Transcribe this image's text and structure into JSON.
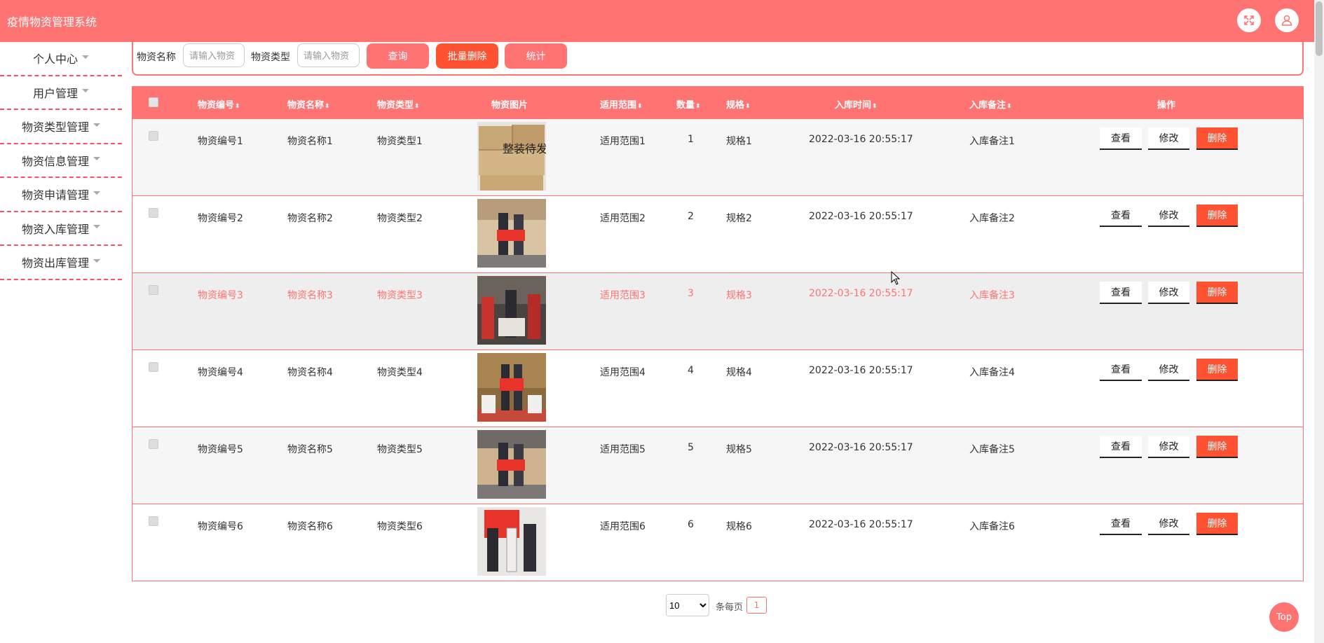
{
  "app": {
    "title": "疫情物资管理系统"
  },
  "header": {
    "fullscreen_icon": "expand-icon",
    "user_icon": "user-icon"
  },
  "sidebar": {
    "items": [
      {
        "label": "个人中心"
      },
      {
        "label": "用户管理"
      },
      {
        "label": "物资类型管理"
      },
      {
        "label": "物资信息管理"
      },
      {
        "label": "物资申请管理"
      },
      {
        "label": "物资入库管理"
      },
      {
        "label": "物资出库管理"
      }
    ]
  },
  "search": {
    "name_label": "物资名称",
    "name_placeholder": "请输入物资",
    "type_label": "物资类型",
    "type_placeholder": "请输入物资",
    "query_button": "查询",
    "batch_delete_button": "批量删除",
    "stats_button": "统计"
  },
  "table": {
    "columns": [
      "物资编号",
      "物资名称",
      "物资类型",
      "物资图片",
      "适用范围",
      "数量",
      "规格",
      "入库时间",
      "入库备注",
      "操作"
    ],
    "sort_icon": "sort-icon",
    "rows": [
      {
        "code": "物资编号1",
        "name": "物资名称1",
        "type": "物资类型1",
        "scope": "适用范围1",
        "qty": "1",
        "spec": "规格1",
        "time": "2022-03-16 20:55:17",
        "note": "入库备注1"
      },
      {
        "code": "物资编号2",
        "name": "物资名称2",
        "type": "物资类型2",
        "scope": "适用范围2",
        "qty": "2",
        "spec": "规格2",
        "time": "2022-03-16 20:55:17",
        "note": "入库备注2"
      },
      {
        "code": "物资编号3",
        "name": "物资名称3",
        "type": "物资类型3",
        "scope": "适用范围3",
        "qty": "3",
        "spec": "规格3",
        "time": "2022-03-16 20:55:17",
        "note": "入库备注3"
      },
      {
        "code": "物资编号4",
        "name": "物资名称4",
        "type": "物资类型4",
        "scope": "适用范围4",
        "qty": "4",
        "spec": "规格4",
        "time": "2022-03-16 20:55:17",
        "note": "入库备注4"
      },
      {
        "code": "物资编号5",
        "name": "物资名称5",
        "type": "物资类型5",
        "scope": "适用范围5",
        "qty": "5",
        "spec": "规格5",
        "time": "2022-03-16 20:55:17",
        "note": "入库备注5"
      },
      {
        "code": "物资编号6",
        "name": "物资名称6",
        "type": "物资类型6",
        "scope": "适用范围6",
        "qty": "6",
        "spec": "规格6",
        "time": "2022-03-16 20:55:17",
        "note": "入库备注6"
      }
    ],
    "row1_photo_text": "整装待发",
    "actions": {
      "view": "查看",
      "edit": "修改",
      "delete": "删除"
    }
  },
  "pagination": {
    "page_size": "10",
    "per_page_label": "条每页",
    "current_page": "1"
  },
  "back_to_top": "Top",
  "colors": {
    "brand": "#ff7373",
    "danger": "#ff5232"
  }
}
